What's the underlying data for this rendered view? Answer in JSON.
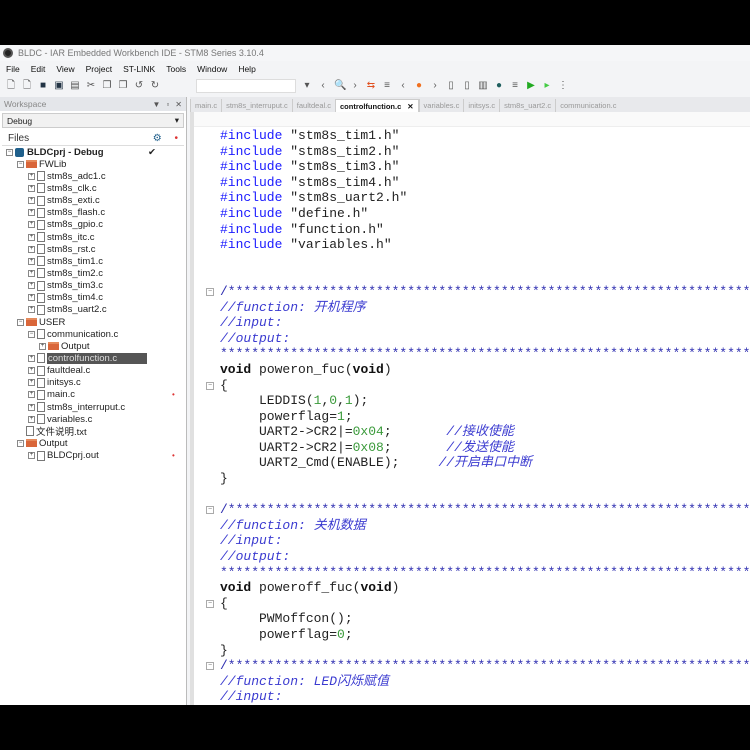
{
  "window": {
    "title": "BLDC - IAR Embedded Workbench IDE - STM8 Series 3.10.4"
  },
  "menu": [
    "File",
    "Edit",
    "View",
    "Project",
    "ST-LINK",
    "Tools",
    "Window",
    "Help"
  ],
  "toolbar_icons": [
    "new-file-icon",
    "open-icon",
    "save-icon",
    "save-all-icon",
    "print-icon",
    "cut-icon",
    "copy-icon",
    "paste-icon",
    "undo-icon",
    "redo-icon",
    "find-dropdown-icon",
    "nav-back-icon",
    "find-icon",
    "nav-forward-icon",
    "toggle-bookmark-icon",
    "indent-icon",
    "prev-icon",
    "debug-bug-icon",
    "next-icon",
    "compile-icon",
    "make-icon",
    "library-icon",
    "stop-build-icon",
    "options-icon",
    "download-debug-icon",
    "debug-no-download-icon",
    "toolbar-more-icon"
  ],
  "workspace": {
    "title": "Workspace",
    "config": "Debug",
    "files_label": "Files"
  },
  "tree": [
    {
      "label": "BLDCprj - Debug",
      "level": 0,
      "kind": "project",
      "exp": "−",
      "check": "✔"
    },
    {
      "label": "FWLib",
      "level": 1,
      "kind": "folder",
      "exp": "−"
    },
    {
      "label": "stm8s_adc1.c",
      "level": 2,
      "kind": "file",
      "exp": "+"
    },
    {
      "label": "stm8s_clk.c",
      "level": 2,
      "kind": "file",
      "exp": "+"
    },
    {
      "label": "stm8s_exti.c",
      "level": 2,
      "kind": "file",
      "exp": "+"
    },
    {
      "label": "stm8s_flash.c",
      "level": 2,
      "kind": "file",
      "exp": "+"
    },
    {
      "label": "stm8s_gpio.c",
      "level": 2,
      "kind": "file",
      "exp": "+"
    },
    {
      "label": "stm8s_itc.c",
      "level": 2,
      "kind": "file",
      "exp": "+"
    },
    {
      "label": "stm8s_rst.c",
      "level": 2,
      "kind": "file",
      "exp": "+"
    },
    {
      "label": "stm8s_tim1.c",
      "level": 2,
      "kind": "file",
      "exp": "+"
    },
    {
      "label": "stm8s_tim2.c",
      "level": 2,
      "kind": "file",
      "exp": "+"
    },
    {
      "label": "stm8s_tim3.c",
      "level": 2,
      "kind": "file",
      "exp": "+"
    },
    {
      "label": "stm8s_tim4.c",
      "level": 2,
      "kind": "file",
      "exp": "+"
    },
    {
      "label": "stm8s_uart2.c",
      "level": 2,
      "kind": "file",
      "exp": "+"
    },
    {
      "label": "USER",
      "level": 1,
      "kind": "folder",
      "exp": "−"
    },
    {
      "label": "communication.c",
      "level": 2,
      "kind": "file",
      "exp": "−"
    },
    {
      "label": "Output",
      "level": 3,
      "kind": "folder",
      "exp": "+"
    },
    {
      "label": "controlfunction.c",
      "level": 2,
      "kind": "file",
      "exp": "+",
      "selected": true
    },
    {
      "label": "faultdeal.c",
      "level": 2,
      "kind": "file",
      "exp": "+"
    },
    {
      "label": "initsys.c",
      "level": 2,
      "kind": "file",
      "exp": "+"
    },
    {
      "label": "main.c",
      "level": 2,
      "kind": "file",
      "exp": "+",
      "dot": true
    },
    {
      "label": "stm8s_interruput.c",
      "level": 2,
      "kind": "file",
      "exp": "+"
    },
    {
      "label": "variables.c",
      "level": 2,
      "kind": "file",
      "exp": "+"
    },
    {
      "label": "文件说明.txt",
      "level": 1,
      "kind": "file",
      "exp": ""
    },
    {
      "label": "Output",
      "level": 1,
      "kind": "folder",
      "exp": "−"
    },
    {
      "label": "BLDCprj.out",
      "level": 2,
      "kind": "file",
      "exp": "+",
      "dot": true
    }
  ],
  "tabs": [
    {
      "label": "main.c"
    },
    {
      "label": "stm8s_interruput.c"
    },
    {
      "label": "faultdeal.c"
    },
    {
      "label": "controlfunction.c",
      "active": true,
      "close": "✕"
    },
    {
      "label": "variables.c"
    },
    {
      "label": "initsys.c"
    },
    {
      "label": "stm8s_uart2.c"
    },
    {
      "label": "communication.c"
    }
  ],
  "code": [
    [
      [
        "kw",
        "#include"
      ],
      [
        "str",
        " \"stm8s_tim1.h\""
      ]
    ],
    [
      [
        "kw",
        "#include"
      ],
      [
        "str",
        " \"stm8s_tim2.h\""
      ]
    ],
    [
      [
        "kw",
        "#include"
      ],
      [
        "str",
        " \"stm8s_tim3.h\""
      ]
    ],
    [
      [
        "kw",
        "#include"
      ],
      [
        "str",
        " \"stm8s_tim4.h\""
      ]
    ],
    [
      [
        "kw",
        "#include"
      ],
      [
        "str",
        " \"stm8s_uart2.h\""
      ]
    ],
    [
      [
        "kw",
        "#include"
      ],
      [
        "str",
        " \"define.h\""
      ]
    ],
    [
      [
        "kw",
        "#include"
      ],
      [
        "str",
        " \"function.h\""
      ]
    ],
    [
      [
        "kw",
        "#include"
      ],
      [
        "str",
        " \"variables.h\""
      ]
    ],
    [],
    [],
    {
      "fold": "−",
      "seg": [
        [
          "star",
          "/**********************************************************************"
        ]
      ]
    },
    [
      [
        "cm",
        "//function: 开机程序"
      ]
    ],
    [
      [
        "cm",
        "//input:"
      ]
    ],
    [
      [
        "cm",
        "//output:"
      ]
    ],
    [
      [
        "star",
        "***********************************************************************"
      ]
    ],
    [
      [
        "bold",
        "void"
      ],
      [
        "pl",
        " poweron_fuc("
      ],
      [
        "bold",
        "void"
      ],
      [
        "pl",
        ")"
      ]
    ],
    {
      "fold": "−",
      "seg": [
        [
          "pl",
          "{"
        ]
      ]
    },
    [
      [
        "pl",
        "     LEDDIS("
      ],
      [
        "num",
        "1"
      ],
      [
        "pl",
        ","
      ],
      [
        "num",
        "0"
      ],
      [
        "pl",
        ","
      ],
      [
        "num",
        "1"
      ],
      [
        "pl",
        ");"
      ]
    ],
    [
      [
        "pl",
        "     powerflag="
      ],
      [
        "num",
        "1"
      ],
      [
        "pl",
        ";"
      ]
    ],
    [
      [
        "pl",
        "     UART2->CR2|="
      ],
      [
        "num",
        "0x04"
      ],
      [
        "pl",
        ";       "
      ],
      [
        "cm",
        "//接收使能"
      ]
    ],
    [
      [
        "pl",
        "     UART2->CR2|="
      ],
      [
        "num",
        "0x08"
      ],
      [
        "pl",
        ";       "
      ],
      [
        "cm",
        "//发送使能"
      ]
    ],
    [
      [
        "pl",
        "     UART2_Cmd(ENABLE);     "
      ],
      [
        "cm",
        "//开启串口中断"
      ]
    ],
    [
      [
        "pl",
        "}"
      ]
    ],
    [],
    {
      "fold": "−",
      "seg": [
        [
          "star",
          "/**********************************************************************"
        ]
      ]
    },
    [
      [
        "cm",
        "//function: 关机数据"
      ]
    ],
    [
      [
        "cm",
        "//input:"
      ]
    ],
    [
      [
        "cm",
        "//output:"
      ]
    ],
    [
      [
        "star",
        "***********************************************************************"
      ]
    ],
    [
      [
        "bold",
        "void"
      ],
      [
        "pl",
        " poweroff_fuc("
      ],
      [
        "bold",
        "void"
      ],
      [
        "pl",
        ")"
      ]
    ],
    {
      "fold": "−",
      "seg": [
        [
          "pl",
          "{"
        ]
      ]
    },
    [
      [
        "pl",
        "     PWMoffcon();"
      ]
    ],
    [
      [
        "pl",
        "     powerflag="
      ],
      [
        "num",
        "0"
      ],
      [
        "pl",
        ";"
      ]
    ],
    [
      [
        "pl",
        "}"
      ]
    ],
    {
      "fold": "−",
      "seg": [
        [
          "star",
          "/**********************************************************************"
        ]
      ]
    },
    [
      [
        "cm",
        "//function: LED闪烁赋值"
      ]
    ],
    [
      [
        "cm",
        "//input:"
      ]
    ]
  ],
  "colors": {
    "keyword": "#1a1aff",
    "comment": "#3b3bd0",
    "number": "#3a9a3a",
    "selection": "#555555"
  }
}
